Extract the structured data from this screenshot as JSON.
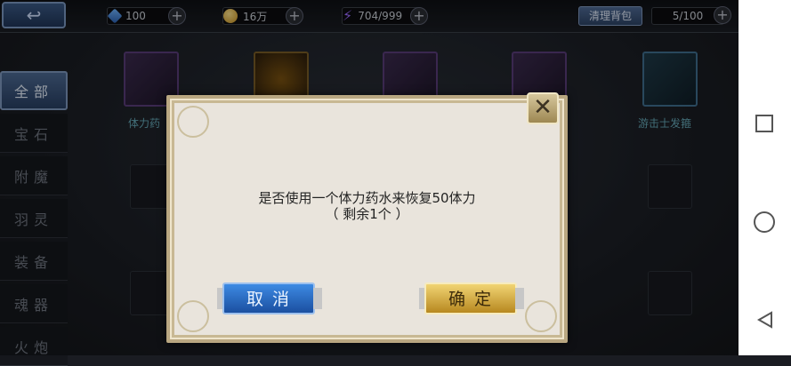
{
  "topbar": {
    "back_label": "↩",
    "gems": "100",
    "gold": "16万",
    "stamina": "704/999",
    "clean_label": "清理背包",
    "capacity": "5/100",
    "plus": "+"
  },
  "sidebar": {
    "items": [
      {
        "label": "全部"
      },
      {
        "label": "宝石"
      },
      {
        "label": "附魔"
      },
      {
        "label": "羽灵"
      },
      {
        "label": "装备"
      },
      {
        "label": "魂器"
      },
      {
        "label": "火炮"
      }
    ]
  },
  "items": {
    "potion_label": "体力药",
    "ranger_label": "游击士发箍"
  },
  "dialog": {
    "message_line1": "是否使用一个体力药水来恢复50体力",
    "message_line2": "（ 剩余1个 ）",
    "cancel_label": "取消",
    "ok_label": "确定",
    "close_label": "✕"
  },
  "colors": {
    "cancel_button": "#2f6fcc",
    "ok_button": "#d9ad3e",
    "dialog_bg": "#e9e4dc"
  }
}
